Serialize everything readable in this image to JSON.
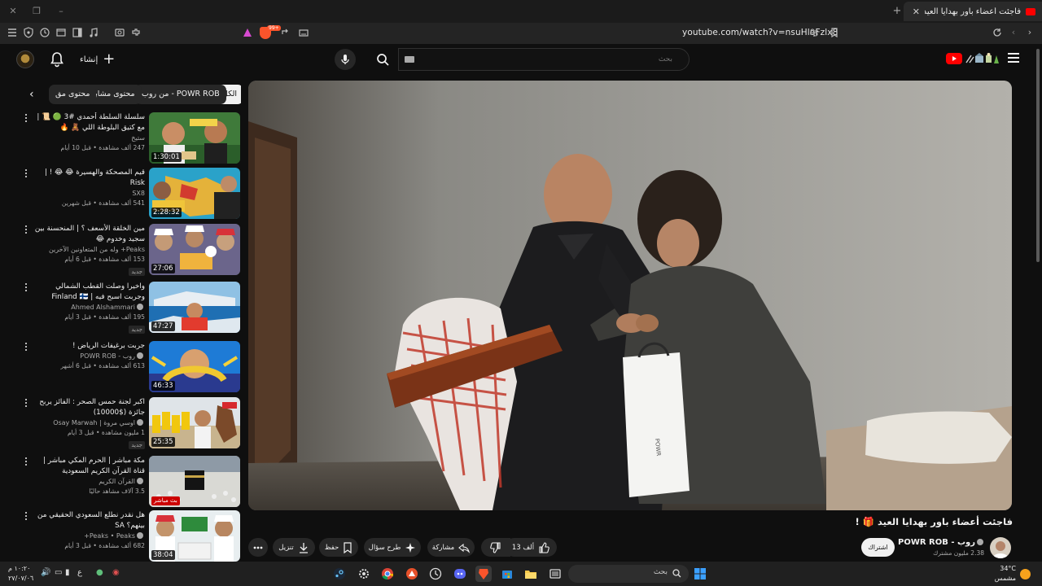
{
  "browser": {
    "tab_title": "فاجئت أعضاء باور بهدايا العيد 🎁 !",
    "url": "youtube.com/watch?v=nsuHlqFzlx8",
    "brave_badge": "99+",
    "new_tab": "+",
    "close_tab": "✕"
  },
  "masthead": {
    "create_label": "إنشاء",
    "search_placeholder": "بحث"
  },
  "chips": [
    {
      "label": "الكل",
      "active": true
    },
    {
      "label": "من روب - POWR ROB"
    },
    {
      "label": "محتوى مشابه"
    },
    {
      "label": "محتوى مق"
    }
  ],
  "sidebar": [
    {
      "title": "سلسلة السلطة أحمدي #3 🟢 📜 | مع كتيق البلوطة اللي 🧸 🔥",
      "channel": "ستيخ",
      "stats": "247 ألف مشاهدة • قبل 10 أيام",
      "duration": "1:30:01",
      "badge": ""
    },
    {
      "title": "قيم المصحكة والهسيرة 😂 😂 ! | Risk",
      "channel": "SX8",
      "stats": "541 ألف مشاهدة • قبل شهرين",
      "duration": "2:28:32",
      "badge": ""
    },
    {
      "title": "مين الخلقة الأسعف ؟ | المنحسنة بين سجيد وخدوم 😂",
      "channel": "Peaks+ وله من المتعاونين الآخرين",
      "stats": "153 ألف مشاهدة • قبل 6 أيام",
      "duration": "27:06",
      "badge": "جديد"
    },
    {
      "title": "واخيرا وصلت القطب الشمالي وجربت اسبح فيه | Finland 🇫🇮",
      "channel": "Ahmed Alshammari",
      "stats": "195 ألف مشاهدة • قبل 3 أيام",
      "duration": "47:27",
      "badge": "جديد"
    },
    {
      "title": "جربت برغيفات الرياض !",
      "channel": "روب - POWR ROB",
      "stats": "613 ألف مشاهدة • قبل 6 أشهر",
      "duration": "46:33",
      "badge": ""
    },
    {
      "title": "اكبر لجنة حمس الصحر : الفائز يربح جائزة ($10000)",
      "channel": "اوسي مروة | Osay Marwah",
      "stats": "1 مليون مشاهدة • قبل 3 أيام",
      "duration": "25:35",
      "badge": "جديد"
    },
    {
      "title": "مكة مباشر | الحرم المكي مباشر | قناة القرآن الكريم السعودية Makkah Live | 🕋 ...",
      "channel": "القرآن الكريم",
      "stats": "3.5 آلاف مشاهد حاليًا",
      "duration": "",
      "live": "بث مباشر",
      "badge": ""
    },
    {
      "title": "هل نقدر نطلع السعودي الحقيقي من بينهم؟ SA",
      "channel": "Peaks • Peaks+",
      "stats": "682 ألف مشاهدة • قبل 3 أيام",
      "duration": "38:04",
      "badge": ""
    }
  ],
  "video": {
    "title": "فاجئت أعضاء باور بهدايا العيد 🎁 !",
    "channel": "روب - POWR ROB",
    "subscribers": "2.38 مليون مشترك",
    "subscribe_label": "اشتراك",
    "likes": "13 ألف",
    "share_label": "مشاركة",
    "ask_label": "طرح سؤال",
    "save_label": "حفظ",
    "download_label": "تنزيل",
    "bag_brand": "POWR"
  },
  "taskbar": {
    "search_label": "بحث",
    "time": "١٠:٢٠ م",
    "date": "٢٧/٠٧/٠٦",
    "temperature": "34°C",
    "weather": "مشمس",
    "lang": "ع"
  }
}
